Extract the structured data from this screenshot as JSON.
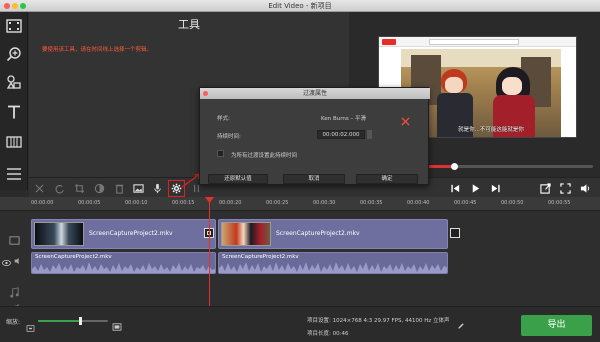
{
  "window": {
    "title": "Edit Video - 新项目"
  },
  "tools_panel": {
    "title": "工具",
    "hint": "要使用该工具，请在时间线上选择一个剪辑。"
  },
  "sidebar": {
    "items": [
      {
        "icon": "film-icon"
      },
      {
        "icon": "zoom-icon"
      },
      {
        "icon": "shapes-icon"
      },
      {
        "icon": "text-icon"
      },
      {
        "icon": "transition-icon"
      },
      {
        "icon": "list-icon"
      }
    ]
  },
  "preview": {
    "subtitle": "就是你...不可能这能就是你"
  },
  "dialog": {
    "title": "过渡属性",
    "style_label": "样式:",
    "style_value": "Ken Burns – 平滑",
    "duration_label": "持续时间:",
    "duration_value": "00:00:02.000",
    "apply_all_label": "为所有过渡设置此持续时间",
    "reset_button": "还原默认值",
    "cancel_button": "取消",
    "ok_button": "确定"
  },
  "ruler": {
    "ticks": [
      "00:00:00",
      "00:00:05",
      "00:00:10",
      "00:00:15",
      "00:00:20",
      "00:00:25",
      "00:00:30",
      "00:00:35",
      "00:00:40",
      "00:00:45",
      "00:00:50",
      "00:00:55"
    ]
  },
  "timeline": {
    "clip1_label": "ScreenCaptureProject2.mkv",
    "clip2_label": "ScreenCaptureProject2.mkv",
    "audio1_label": "ScreenCaptureProject2.mkv",
    "audio2_label": "ScreenCaptureProject2.mkv"
  },
  "bottom": {
    "zoom_label": "缩放:",
    "project_settings": "项目设置:  1024×768 4:3 29.97 FPS, 44100 Hz 立体声",
    "project_length": "项目长度:  00:46",
    "export_button": "导出"
  },
  "colors": {
    "accent_green": "#3aa14a",
    "warning_red": "#ff5a3c",
    "highlight_red": "#e02020",
    "clip_purple": "#6f6f9f"
  }
}
